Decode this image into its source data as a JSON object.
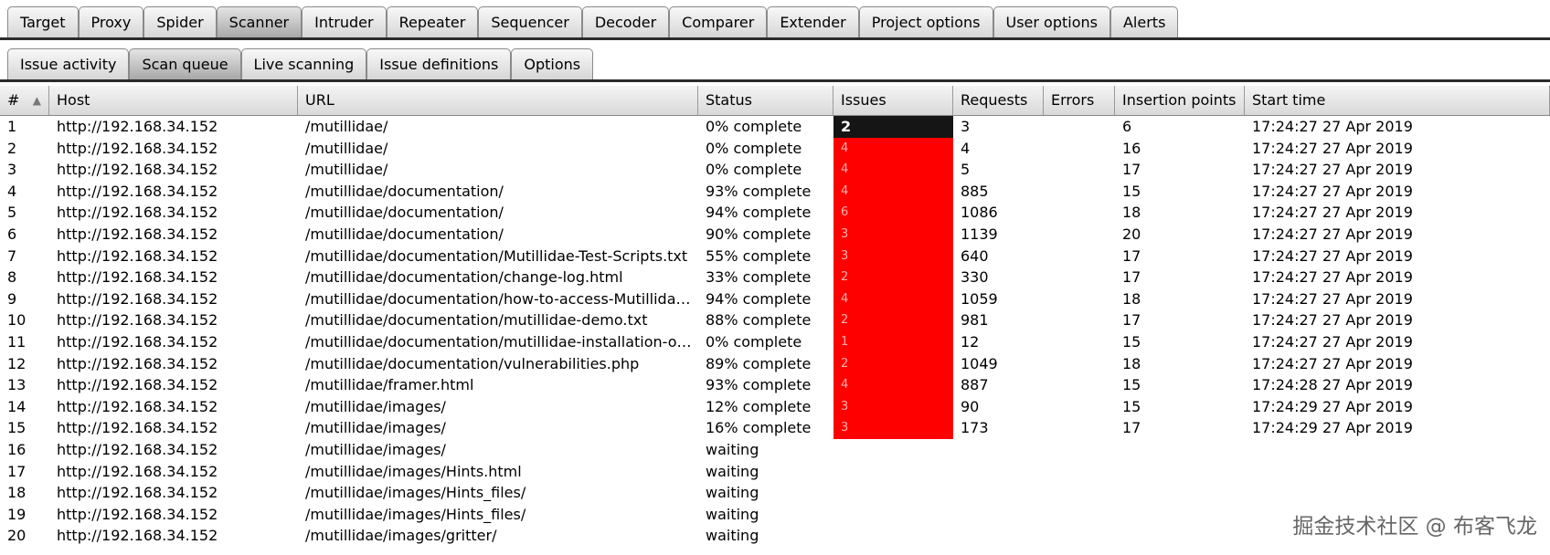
{
  "main_tabs": [
    {
      "label": "Target",
      "active": false
    },
    {
      "label": "Proxy",
      "active": false
    },
    {
      "label": "Spider",
      "active": false
    },
    {
      "label": "Scanner",
      "active": true
    },
    {
      "label": "Intruder",
      "active": false
    },
    {
      "label": "Repeater",
      "active": false
    },
    {
      "label": "Sequencer",
      "active": false
    },
    {
      "label": "Decoder",
      "active": false
    },
    {
      "label": "Comparer",
      "active": false
    },
    {
      "label": "Extender",
      "active": false
    },
    {
      "label": "Project options",
      "active": false
    },
    {
      "label": "User options",
      "active": false
    },
    {
      "label": "Alerts",
      "active": false
    }
  ],
  "sub_tabs": [
    {
      "label": "Issue activity",
      "active": false
    },
    {
      "label": "Scan queue",
      "active": true
    },
    {
      "label": "Live scanning",
      "active": false
    },
    {
      "label": "Issue definitions",
      "active": false
    },
    {
      "label": "Options",
      "active": false
    }
  ],
  "columns": [
    "#",
    "Host",
    "URL",
    "Status",
    "Issues",
    "Requests",
    "Errors",
    "Insertion points",
    "Start time"
  ],
  "sort_icon": "sort-ascending-icon",
  "colors": {
    "issues_red": "#ff0000",
    "issues_selected": "#151515"
  },
  "rows": [
    {
      "n": "1",
      "host": "http://192.168.34.152",
      "url": "/mutillidae/",
      "status": "0% complete",
      "issues": "2",
      "issues_style": "dark",
      "requests": "3",
      "errors": "",
      "insertion": "6",
      "start": "17:24:27 27 Apr 2019"
    },
    {
      "n": "2",
      "host": "http://192.168.34.152",
      "url": "/mutillidae/",
      "status": "0% complete",
      "issues": "4",
      "issues_style": "red",
      "requests": "4",
      "errors": "",
      "insertion": "16",
      "start": "17:24:27 27 Apr 2019"
    },
    {
      "n": "3",
      "host": "http://192.168.34.152",
      "url": "/mutillidae/",
      "status": "0% complete",
      "issues": "4",
      "issues_style": "red",
      "requests": "5",
      "errors": "",
      "insertion": "17",
      "start": "17:24:27 27 Apr 2019"
    },
    {
      "n": "4",
      "host": "http://192.168.34.152",
      "url": "/mutillidae/documentation/",
      "status": "93% complete",
      "issues": "4",
      "issues_style": "red",
      "requests": "885",
      "errors": "",
      "insertion": "15",
      "start": "17:24:27 27 Apr 2019"
    },
    {
      "n": "5",
      "host": "http://192.168.34.152",
      "url": "/mutillidae/documentation/",
      "status": "94% complete",
      "issues": "6",
      "issues_style": "red",
      "requests": "1086",
      "errors": "",
      "insertion": "18",
      "start": "17:24:27 27 Apr 2019"
    },
    {
      "n": "6",
      "host": "http://192.168.34.152",
      "url": "/mutillidae/documentation/",
      "status": "90% complete",
      "issues": "3",
      "issues_style": "red",
      "requests": "1139",
      "errors": "",
      "insertion": "20",
      "start": "17:24:27 27 Apr 2019"
    },
    {
      "n": "7",
      "host": "http://192.168.34.152",
      "url": "/mutillidae/documentation/Mutillidae-Test-Scripts.txt",
      "status": "55% complete",
      "issues": "3",
      "issues_style": "red",
      "requests": "640",
      "errors": "",
      "insertion": "17",
      "start": "17:24:27 27 Apr 2019"
    },
    {
      "n": "8",
      "host": "http://192.168.34.152",
      "url": "/mutillidae/documentation/change-log.html",
      "status": "33% complete",
      "issues": "2",
      "issues_style": "red",
      "requests": "330",
      "errors": "",
      "insertion": "17",
      "start": "17:24:27 27 Apr 2019"
    },
    {
      "n": "9",
      "host": "http://192.168.34.152",
      "url": "/mutillidae/documentation/how-to-access-Mutillidae...",
      "status": "94% complete",
      "issues": "4",
      "issues_style": "red",
      "requests": "1059",
      "errors": "",
      "insertion": "18",
      "start": "17:24:27 27 Apr 2019"
    },
    {
      "n": "10",
      "host": "http://192.168.34.152",
      "url": "/mutillidae/documentation/mutillidae-demo.txt",
      "status": "88% complete",
      "issues": "2",
      "issues_style": "red",
      "requests": "981",
      "errors": "",
      "insertion": "17",
      "start": "17:24:27 27 Apr 2019"
    },
    {
      "n": "11",
      "host": "http://192.168.34.152",
      "url": "/mutillidae/documentation/mutillidae-installation-on...",
      "status": "0% complete",
      "issues": "1",
      "issues_style": "red",
      "requests": "12",
      "errors": "",
      "insertion": "15",
      "start": "17:24:27 27 Apr 2019"
    },
    {
      "n": "12",
      "host": "http://192.168.34.152",
      "url": "/mutillidae/documentation/vulnerabilities.php",
      "status": "89% complete",
      "issues": "2",
      "issues_style": "red",
      "requests": "1049",
      "errors": "",
      "insertion": "18",
      "start": "17:24:27 27 Apr 2019"
    },
    {
      "n": "13",
      "host": "http://192.168.34.152",
      "url": "/mutillidae/framer.html",
      "status": "93% complete",
      "issues": "4",
      "issues_style": "red",
      "requests": "887",
      "errors": "",
      "insertion": "15",
      "start": "17:24:28 27 Apr 2019"
    },
    {
      "n": "14",
      "host": "http://192.168.34.152",
      "url": "/mutillidae/images/",
      "status": "12% complete",
      "issues": "3",
      "issues_style": "red",
      "requests": "90",
      "errors": "",
      "insertion": "15",
      "start": "17:24:29 27 Apr 2019"
    },
    {
      "n": "15",
      "host": "http://192.168.34.152",
      "url": "/mutillidae/images/",
      "status": "16% complete",
      "issues": "3",
      "issues_style": "red",
      "requests": "173",
      "errors": "",
      "insertion": "17",
      "start": "17:24:29 27 Apr 2019"
    },
    {
      "n": "16",
      "host": "http://192.168.34.152",
      "url": "/mutillidae/images/",
      "status": "waiting",
      "issues": "",
      "issues_style": "none",
      "requests": "",
      "errors": "",
      "insertion": "",
      "start": ""
    },
    {
      "n": "17",
      "host": "http://192.168.34.152",
      "url": "/mutillidae/images/Hints.html",
      "status": "waiting",
      "issues": "",
      "issues_style": "none",
      "requests": "",
      "errors": "",
      "insertion": "",
      "start": ""
    },
    {
      "n": "18",
      "host": "http://192.168.34.152",
      "url": "/mutillidae/images/Hints_files/",
      "status": "waiting",
      "issues": "",
      "issues_style": "none",
      "requests": "",
      "errors": "",
      "insertion": "",
      "start": ""
    },
    {
      "n": "19",
      "host": "http://192.168.34.152",
      "url": "/mutillidae/images/Hints_files/",
      "status": "waiting",
      "issues": "",
      "issues_style": "none",
      "requests": "",
      "errors": "",
      "insertion": "",
      "start": ""
    },
    {
      "n": "20",
      "host": "http://192.168.34.152",
      "url": "/mutillidae/images/gritter/",
      "status": "waiting",
      "issues": "",
      "issues_style": "none",
      "requests": "",
      "errors": "",
      "insertion": "",
      "start": ""
    }
  ],
  "watermark": "掘金技术社区 @ 布客飞龙"
}
